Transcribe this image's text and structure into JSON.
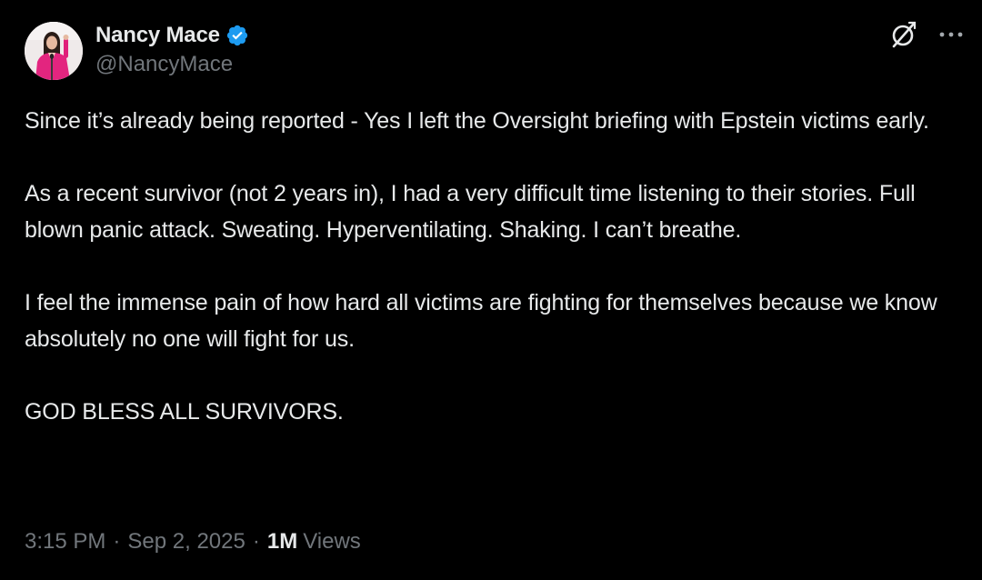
{
  "author": {
    "display_name": "Nancy Mace",
    "handle": "@NancyMace",
    "verified": true,
    "verified_color": "#1d9bf0",
    "avatar_icon": "profile-photo"
  },
  "top_actions": {
    "grok_icon": "grok-icon",
    "more_icon": "more-horizontal-icon"
  },
  "post": {
    "paragraphs": [
      "Since it’s already being reported - Yes I left the Oversight briefing with Epstein victims early.",
      "As a recent survivor (not 2 years in), I had a very difficult time listening to their stories. Full blown panic attack. Sweating. Hyperventilating. Shaking. I can’t breathe.",
      "I feel the immense pain of how hard all victims are fighting for themselves because we know absolutely no one will fight for us.",
      "GOD BLESS ALL SURVIVORS."
    ]
  },
  "meta": {
    "time": "3:15 PM",
    "separator": "·",
    "date": "Sep 2, 2025",
    "views_count": "1M",
    "views_label": "Views"
  },
  "colors": {
    "background": "#000000",
    "text_primary": "#e7e9ea",
    "text_secondary": "#71767b",
    "accent": "#1d9bf0"
  }
}
